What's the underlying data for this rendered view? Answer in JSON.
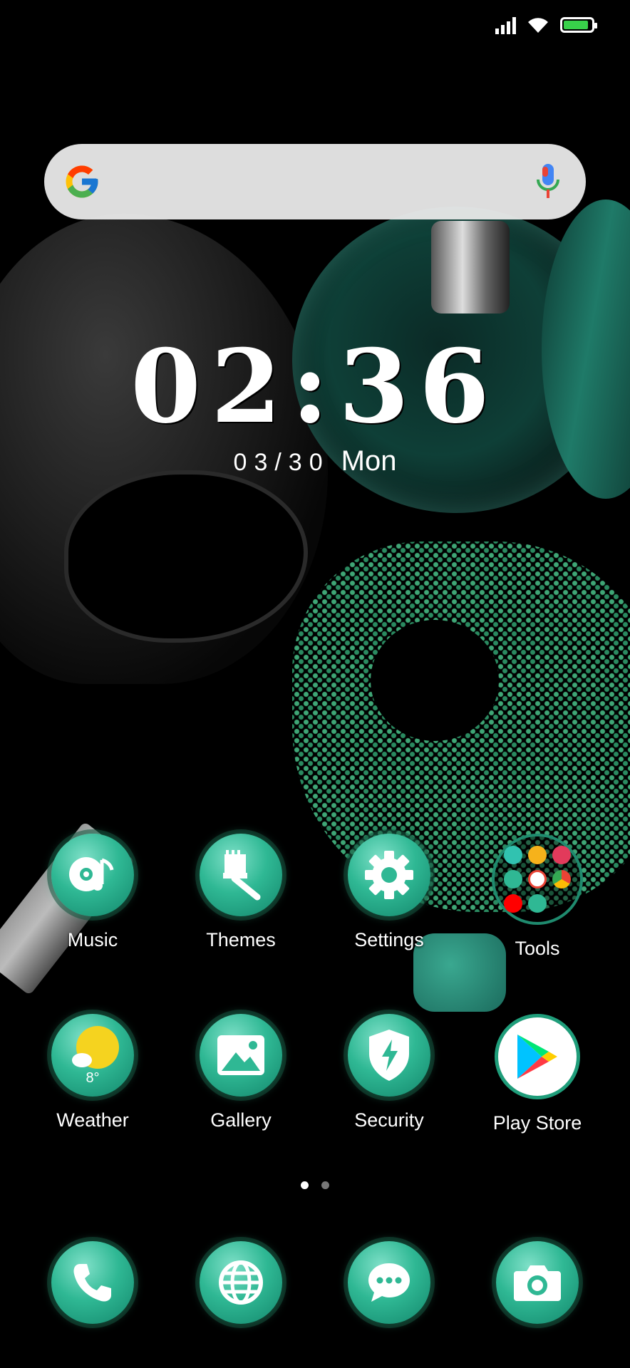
{
  "status_bar": {
    "battery_percent": 80,
    "battery_color": "#38d24a"
  },
  "search": {
    "g_logo": "google-logo",
    "mic": "mic-icon"
  },
  "clock": {
    "time": "02:36",
    "date": "03/30",
    "day": "Mon"
  },
  "apps": [
    {
      "label": "Music",
      "icon": "music-icon"
    },
    {
      "label": "Themes",
      "icon": "paintbrush-icon"
    },
    {
      "label": "Settings",
      "icon": "gear-icon"
    },
    {
      "label": "Tools",
      "icon": "folder-icon"
    },
    {
      "label": "Weather",
      "icon": "weather-icon",
      "temp": "8°"
    },
    {
      "label": "Gallery",
      "icon": "image-icon"
    },
    {
      "label": "Security",
      "icon": "shield-icon"
    },
    {
      "label": "Play Store",
      "icon": "play-store-icon"
    }
  ],
  "pager": {
    "pages": 2,
    "current": 1
  },
  "dock": [
    {
      "icon": "phone-icon"
    },
    {
      "icon": "globe-icon"
    },
    {
      "icon": "message-icon"
    },
    {
      "icon": "camera-icon"
    }
  ],
  "colors": {
    "icon_accent": "#2fb894",
    "search_bg": "#ebebeb"
  }
}
